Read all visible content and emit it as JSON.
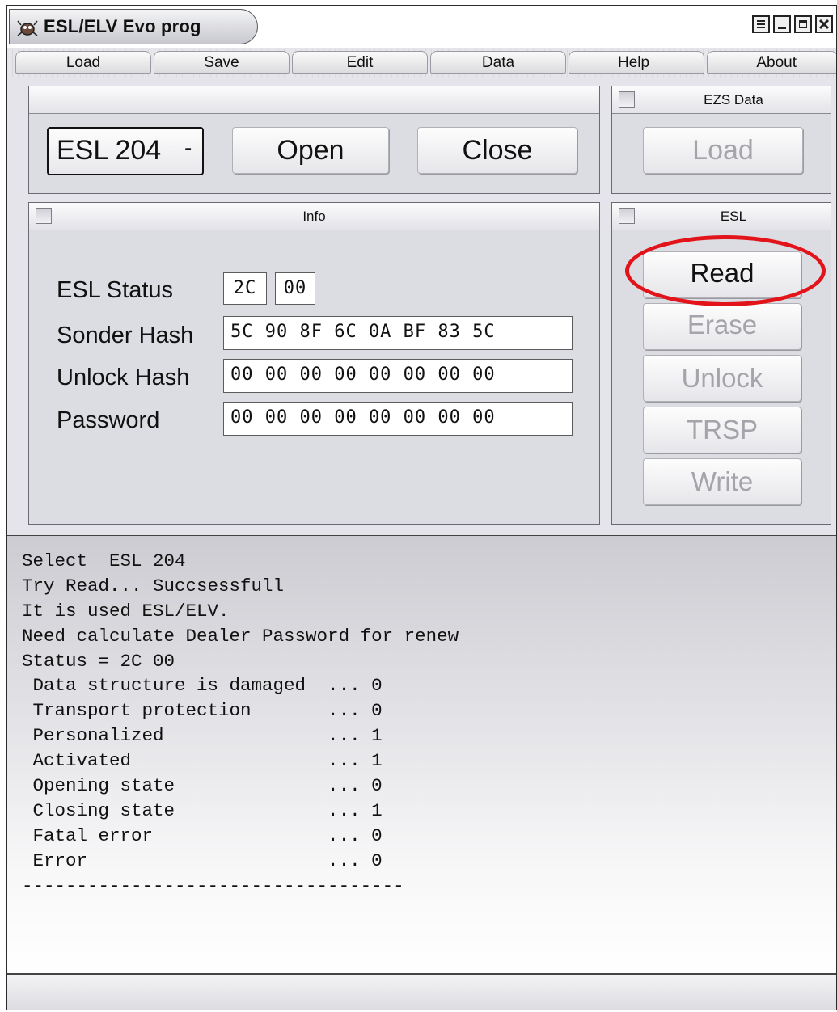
{
  "window": {
    "title": "ESL/ELV Evo prog",
    "app_icon": "app-bug-icon",
    "controls": [
      "menu-icon",
      "minimize-icon",
      "maximize-icon",
      "close-icon"
    ]
  },
  "menu": [
    "Load",
    "Save",
    "Edit",
    "Data",
    "Help",
    "About"
  ],
  "device_panel": {
    "header": "",
    "selected_device": "ESL 204",
    "open_label": "Open",
    "close_label": "Close"
  },
  "ezs_panel": {
    "title": "EZS Data",
    "load_label": "Load"
  },
  "info_panel": {
    "title": "Info",
    "status_label": "ESL Status",
    "status_byte1": "2C",
    "status_byte2": "00",
    "sonder_label": "Sonder Hash",
    "sonder_value": "5C 90 8F 6C 0A BF 83 5C",
    "unlock_label": "Unlock Hash",
    "unlock_value": "00 00 00 00 00 00 00 00",
    "password_label": "Password",
    "password_value": "00 00 00 00 00 00 00 00"
  },
  "esl_panel": {
    "title": "ESL",
    "read_label": "Read",
    "erase_label": "Erase",
    "unlock_label": "Unlock",
    "trsp_label": "TRSP",
    "write_label": "Write"
  },
  "log_lines": [
    "Select  ESL 204",
    "Try Read... Succsessfull",
    "It is used ESL/ELV.",
    "Need calculate Dealer Password for renew",
    "Status = 2C 00",
    " Data structure is damaged  ... 0",
    " Transport protection       ... 0",
    " Personalized               ... 1",
    " Activated                  ... 1",
    " Opening state              ... 0",
    " Closing state              ... 1",
    " Fatal error                ... 0",
    " Error                      ... 0",
    "-----------------------------------"
  ],
  "status_bar": "",
  "colors": {
    "highlight_ellipse": "#e3131a",
    "disabled_text": "#a4a4aa"
  }
}
